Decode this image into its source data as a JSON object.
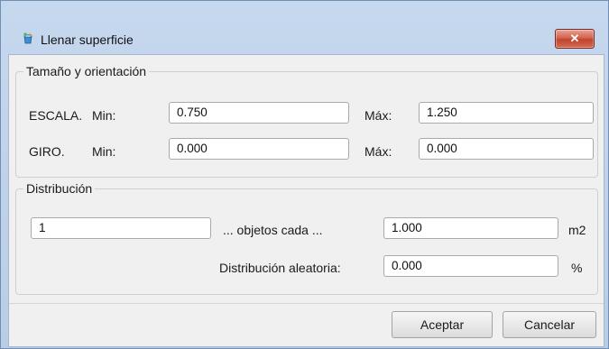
{
  "window": {
    "title": "Llenar superficie",
    "close_glyph": "✕",
    "icon": "app-bucket-icon"
  },
  "size_orientation": {
    "legend": "Tamaño y orientación",
    "scale": {
      "label": "ESCALA.",
      "min_label": "Min:",
      "min_value": "0.750",
      "max_label": "Máx:",
      "max_value": "1.250"
    },
    "rotation": {
      "label": "GIRO.",
      "min_label": "Min:",
      "min_value": "0.000",
      "max_label": "Máx:",
      "max_value": "0.000"
    }
  },
  "distribution": {
    "legend": "Distribución",
    "count_value": "1",
    "objects_each_label": "... objetos cada ...",
    "area_value": "1.000",
    "area_unit": "m2",
    "random_label": "Distribución aleatoria:",
    "random_value": "0.000",
    "random_unit": "%"
  },
  "buttons": {
    "accept": "Aceptar",
    "cancel": "Cancelar"
  }
}
